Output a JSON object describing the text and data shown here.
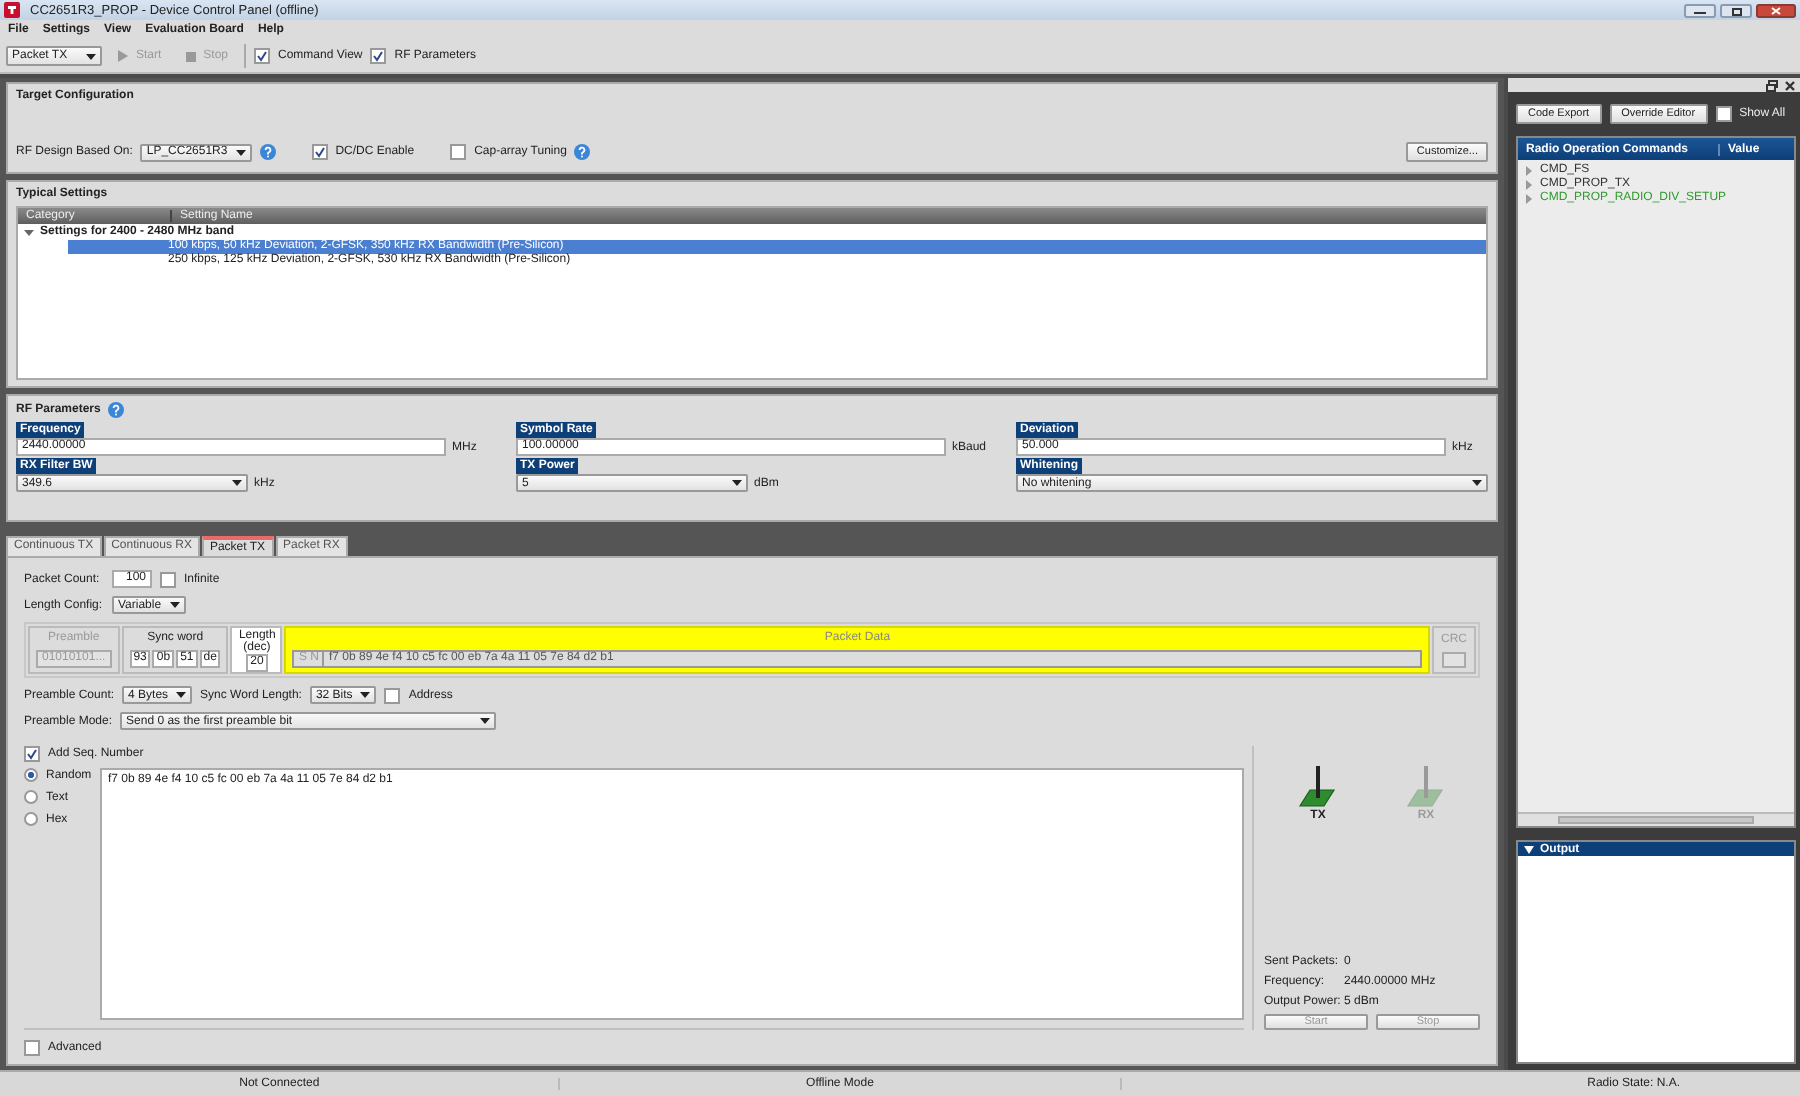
{
  "window": {
    "title": "CC2651R3_PROP - Device Control Panel (offline)"
  },
  "menu": [
    {
      "label": "File"
    },
    {
      "label": "Settings"
    },
    {
      "label": "View"
    },
    {
      "label": "Evaluation Board"
    },
    {
      "label": "Help"
    }
  ],
  "toolbar": {
    "mode": "Packet TX",
    "start": {
      "label": "Start",
      "disabled": true
    },
    "stop": {
      "label": "Stop",
      "disabled": true
    },
    "checks": [
      {
        "label": "Command View",
        "checked": true
      },
      {
        "label": "RF Parameters",
        "checked": true
      }
    ]
  },
  "target_config": {
    "title": "Target Configuration",
    "rf_design_label": "RF Design Based On:",
    "rf_design_value": "LP_CC2651R3",
    "checks": [
      {
        "label": "DC/DC Enable",
        "checked": true,
        "help": false
      },
      {
        "label": "Cap-array Tuning",
        "checked": false,
        "help": true
      }
    ],
    "customize": "Customize..."
  },
  "typical_settings": {
    "title": "Typical Settings",
    "columns": [
      "Category",
      "Setting Name"
    ],
    "groups": [
      {
        "label": "Settings for 2400 - 2480 MHz band",
        "expanded": true,
        "children": [
          {
            "label": "100 kbps, 50 kHz Deviation, 2-GFSK, 350 kHz RX Bandwidth (Pre-Silicon)",
            "selected": true
          },
          {
            "label": "250 kbps, 125 kHz Deviation, 2-GFSK, 530 kHz RX Bandwidth (Pre-Silicon)",
            "selected": false
          }
        ]
      }
    ]
  },
  "rf_parameters": {
    "title": "RF Parameters",
    "fields": [
      {
        "label": "Frequency",
        "kind": "input",
        "value": "2440.00000",
        "unit": "MHz"
      },
      {
        "label": "Symbol Rate",
        "kind": "input",
        "value": "100.00000",
        "unit": "kBaud"
      },
      {
        "label": "Deviation",
        "kind": "input",
        "value": "50.000",
        "unit": "kHz"
      },
      {
        "label": "RX Filter BW",
        "kind": "select",
        "value": "349.6",
        "unit": "kHz"
      },
      {
        "label": "TX Power",
        "kind": "select",
        "value": "5",
        "unit": "dBm"
      },
      {
        "label": "Whitening",
        "kind": "select",
        "value": "No whitening"
      }
    ]
  },
  "tabs": [
    {
      "label": "Continuous TX",
      "selected": false
    },
    {
      "label": "Continuous RX",
      "selected": false
    },
    {
      "label": "Packet TX",
      "selected": true
    },
    {
      "label": "Packet RX",
      "selected": false
    }
  ],
  "packet_tx": {
    "packet_count": {
      "label": "Packet Count:",
      "value": "100"
    },
    "infinite": {
      "label": "Infinite",
      "checked": false
    },
    "length_config": {
      "label": "Length Config:",
      "value": "Variable"
    },
    "frame": {
      "preamble": {
        "label": "Preamble",
        "value": "01010101..."
      },
      "sync_word": {
        "label": "Sync word",
        "bytes": [
          "93",
          "0b",
          "51",
          "de"
        ]
      },
      "length": {
        "label": "Length (dec)",
        "value": "20"
      },
      "packet_data": {
        "label": "Packet Data",
        "prefix": "S N",
        "value": "f7 0b 89 4e f4 10 c5 fc 00 eb 7a 4a 11 05 7e 84 d2 b1"
      },
      "crc": {
        "label": "CRC"
      }
    },
    "preamble_count": {
      "label": "Preamble Count:",
      "value": "4 Bytes"
    },
    "sync_word_length": {
      "label": "Sync Word Length:",
      "value": "32 Bits"
    },
    "address": {
      "label": "Address",
      "checked": false
    },
    "preamble_mode": {
      "label": "Preamble Mode:",
      "value": "Send 0 as the first preamble bit"
    },
    "add_seq": {
      "label": "Add Seq. Number",
      "checked": true
    },
    "payload_modes": [
      {
        "label": "Random",
        "selected": true
      },
      {
        "label": "Text",
        "selected": false
      },
      {
        "label": "Hex",
        "selected": false
      }
    ],
    "payload": "f7 0b 89 4e f4 10 c5 fc 00 eb 7a 4a 11 05 7e 84 d2 b1",
    "advanced": {
      "label": "Advanced",
      "checked": false
    },
    "radios": [
      {
        "label": "TX",
        "active": true
      },
      {
        "label": "RX",
        "active": false
      }
    ],
    "stats": [
      {
        "label": "Sent Packets:",
        "value": "0"
      },
      {
        "label": "Frequency:",
        "value": "2440.00000 MHz"
      },
      {
        "label": "Output Power:",
        "value": "5 dBm"
      }
    ],
    "buttons": [
      {
        "label": "Start"
      },
      {
        "label": "Stop"
      }
    ]
  },
  "side_panel": {
    "buttons": [
      "Code Export",
      "Override Editor"
    ],
    "show_all": {
      "label": "Show All",
      "checked": false
    },
    "columns": [
      "Radio Operation Commands",
      "Value"
    ],
    "commands": [
      {
        "label": "CMD_FS",
        "color": "#333333"
      },
      {
        "label": "CMD_PROP_TX",
        "color": "#333333"
      },
      {
        "label": "CMD_PROP_RADIO_DIV_SETUP",
        "color": "#2e9a2e"
      }
    ],
    "output": {
      "title": "Output",
      "expanded": true
    }
  },
  "status_bar": [
    "Not Connected",
    "Offline Mode",
    "Radio State: N.A."
  ]
}
